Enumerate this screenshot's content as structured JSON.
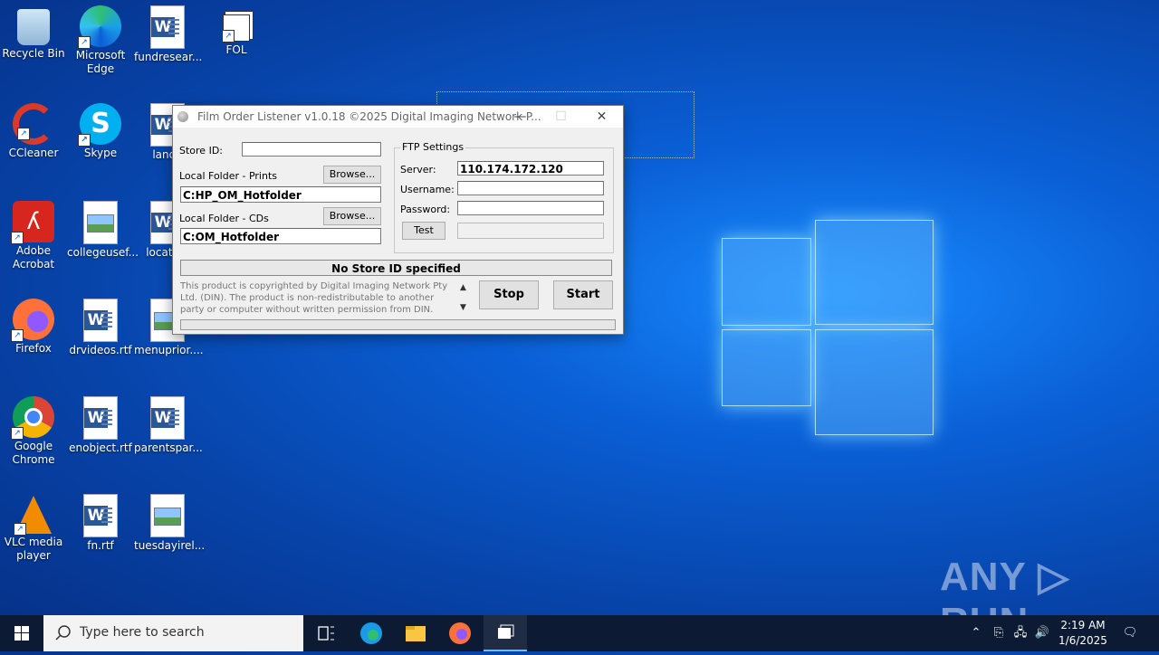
{
  "desktop": {
    "icons": [
      {
        "label": "Recycle Bin"
      },
      {
        "label": "Microsoft Edge"
      },
      {
        "label": "fundresear..."
      },
      {
        "label": "FOL"
      },
      {
        "label": "CCleaner"
      },
      {
        "label": "Skype"
      },
      {
        "label": "lande"
      },
      {
        "label": "Adobe Acrobat"
      },
      {
        "label": "collegeusef..."
      },
      {
        "label": "location"
      },
      {
        "label": "Firefox"
      },
      {
        "label": "drvideos.rtf"
      },
      {
        "label": "menuprior...."
      },
      {
        "label": "Google Chrome"
      },
      {
        "label": "enobject.rtf"
      },
      {
        "label": "parentspar..."
      },
      {
        "label": "VLC media player"
      },
      {
        "label": "fn.rtf"
      },
      {
        "label": "tuesdayirel..."
      }
    ]
  },
  "dialog": {
    "title": "Film Order Listener  v1.0.18 ©2025 Digital Imaging Network P...",
    "minimize": "—",
    "maximize": "☐",
    "close": "✕",
    "store_id_label": "Store ID:",
    "store_id_value": "",
    "prints_label": "Local Folder - Prints",
    "prints_browse": "Browse...",
    "prints_value": "C:HP_OM_Hotfolder",
    "cds_label": "Local Folder - CDs",
    "cds_browse": "Browse...",
    "cds_value": "C:OM_Hotfolder",
    "ftp_title": "FTP Settings",
    "server_label": "Server:",
    "server_value": "110.174.172.120",
    "username_label": "Username:",
    "username_value": "",
    "password_label": "Password:",
    "password_value": "",
    "test_label": "Test",
    "status": "No Store ID specified",
    "copyright": "This product is copyrighted by Digital Imaging Network Pty Ltd. (DIN). The product is non-redistributable to another party or computer without written permission from DIN. The product must",
    "stop_label": "Stop",
    "start_label": "Start"
  },
  "taskbar": {
    "search_placeholder": "Type here to search",
    "time": "2:19 AM",
    "date": "1/6/2025"
  },
  "watermark": "ANY ▷ RUN"
}
